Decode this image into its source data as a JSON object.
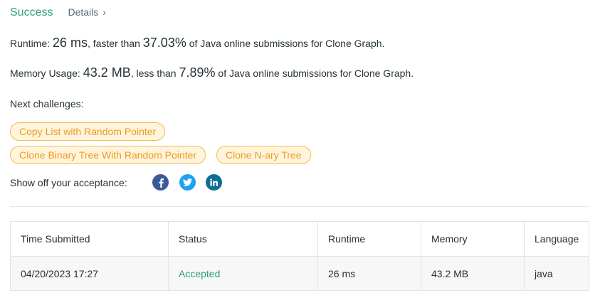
{
  "header": {
    "status": "Success",
    "details_label": "Details",
    "details_chevron": "›"
  },
  "runtime": {
    "label": "Runtime:",
    "value": "26 ms",
    "mid_text": ", faster than",
    "percent": "37.03%",
    "suffix": "of Java online submissions for Clone Graph."
  },
  "memory": {
    "label": "Memory Usage:",
    "value": "43.2 MB",
    "mid_text": ", less than",
    "percent": "7.89%",
    "suffix": "of Java online submissions for Clone Graph."
  },
  "next_challenges": {
    "label": "Next challenges:",
    "items": [
      "Copy List with Random Pointer",
      "Clone Binary Tree With Random Pointer",
      "Clone N-ary Tree"
    ]
  },
  "share": {
    "label": "Show off your acceptance:",
    "icons": [
      "facebook-icon",
      "twitter-icon",
      "linkedin-icon"
    ]
  },
  "table": {
    "headers": [
      "Time Submitted",
      "Status",
      "Runtime",
      "Memory",
      "Language"
    ],
    "rows": [
      {
        "time": "04/20/2023 17:27",
        "status": "Accepted",
        "runtime": "26 ms",
        "memory": "43.2 MB",
        "language": "java"
      }
    ]
  },
  "colors": {
    "success": "#2e9e84",
    "chip_text": "#ef9b1f",
    "chip_bg": "#fff4dc",
    "chip_border": "#f5b94d",
    "facebook": "#3b5998",
    "twitter": "#1da1f2",
    "linkedin": "#0e6f96"
  }
}
